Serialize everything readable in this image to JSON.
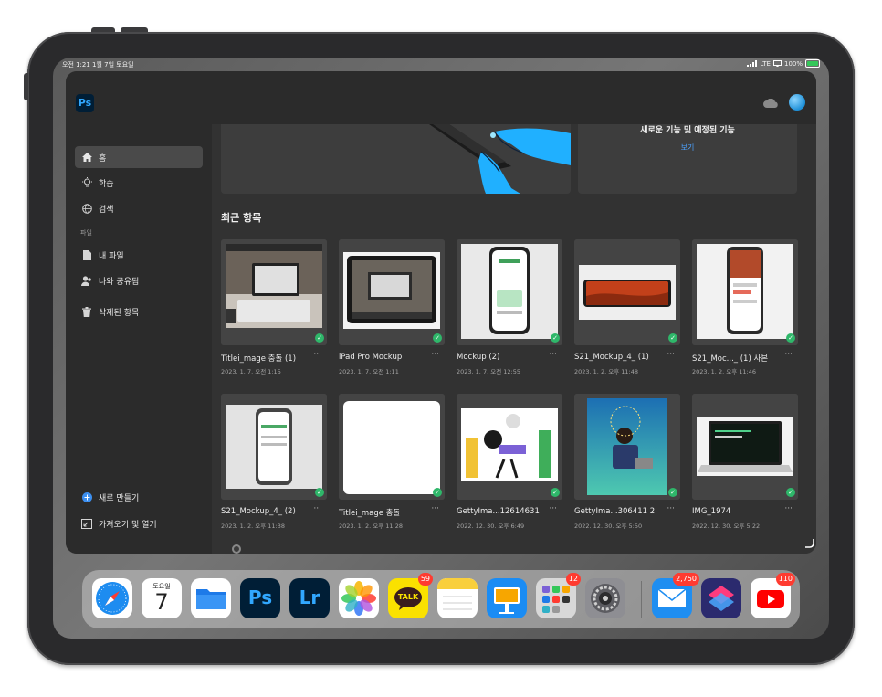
{
  "status_bar": {
    "time_date": "오전 1:21   1월 7일 토요일",
    "network": "LTE",
    "battery": "100%"
  },
  "app": {
    "logo": "Ps"
  },
  "sidebar": {
    "items": [
      {
        "label": "홈",
        "icon": "home-icon"
      },
      {
        "label": "학습",
        "icon": "lightbulb-icon"
      },
      {
        "label": "검색",
        "icon": "globe-icon"
      }
    ],
    "files_section_label": "파일",
    "file_items": [
      {
        "label": "내 파일",
        "icon": "file-icon"
      },
      {
        "label": "나와 공유됨",
        "icon": "people-icon"
      },
      {
        "label": "삭제된 항목",
        "icon": "trash-icon"
      }
    ],
    "bottom_items": [
      {
        "label": "새로 만들기",
        "icon": "plus-circle-icon"
      },
      {
        "label": "가져오기 및 열기",
        "icon": "import-icon"
      }
    ]
  },
  "banner": {
    "title": "새로운 기능 및 예정된 기능",
    "link": "보기"
  },
  "recent": {
    "title": "최근 항목",
    "items": [
      {
        "name": "Titlei_mage 충돌 (1)",
        "date": "2023. 1. 7. 오전 1:15"
      },
      {
        "name": "iPad Pro Mockup",
        "date": "2023. 1. 7. 오전 1:11"
      },
      {
        "name": "Mockup (2)",
        "date": "2023. 1. 7. 오전 12:55"
      },
      {
        "name": "S21_Mockup_4_ (1)",
        "date": "2023. 1. 2. 오후 11:48"
      },
      {
        "name": "S21_Moc..._ (1) 사본",
        "date": "2023. 1. 2. 오후 11:46"
      },
      {
        "name": "S21_Mockup_4_ (2)",
        "date": "2023. 1. 2. 오후 11:38"
      },
      {
        "name": "Titlei_mage 충돌",
        "date": "2023. 1. 2. 오후 11:28"
      },
      {
        "name": "GettyIma...12614631",
        "date": "2022. 12. 30. 오후 6:49"
      },
      {
        "name": "GettyIma...306411 2",
        "date": "2022. 12. 30. 오후 5:50"
      },
      {
        "name": "IMG_1974",
        "date": "2022. 12. 30. 오후 5:22"
      }
    ]
  },
  "dock": {
    "calendar_weekday": "토요일",
    "calendar_day": "7",
    "kakao_label": "TALK",
    "ps_label": "Ps",
    "lr_label": "Lr",
    "apps": [
      {
        "name": "Safari",
        "badge": ""
      },
      {
        "name": "Calendar",
        "badge": ""
      },
      {
        "name": "Files",
        "badge": ""
      },
      {
        "name": "Photoshop",
        "badge": ""
      },
      {
        "name": "Lightroom",
        "badge": ""
      },
      {
        "name": "Photos",
        "badge": ""
      },
      {
        "name": "KakaoTalk",
        "badge": "59"
      },
      {
        "name": "Notes",
        "badge": ""
      },
      {
        "name": "Keynote",
        "badge": ""
      },
      {
        "name": "Folder",
        "badge": "12"
      },
      {
        "name": "Settings",
        "badge": ""
      },
      {
        "name": "Mail",
        "badge": "2,750"
      },
      {
        "name": "Shortcuts",
        "badge": ""
      },
      {
        "name": "YouTube",
        "badge": "110"
      }
    ]
  },
  "colors": {
    "accent_blue": "#31a8ff",
    "link_blue": "#4da3ff",
    "check_green": "#2fb76a",
    "badge_red": "#ff3b30"
  }
}
